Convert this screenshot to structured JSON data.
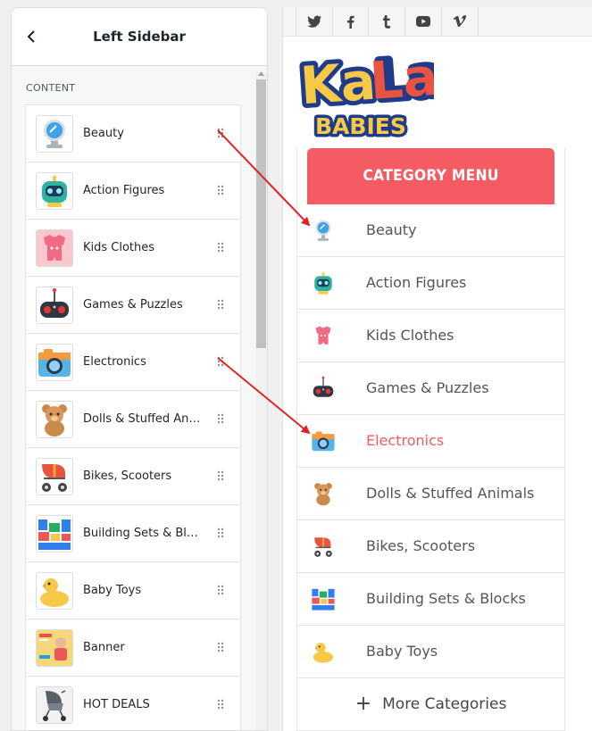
{
  "sidebar": {
    "title": "Left Sidebar",
    "section_label": "CONTENT",
    "items": [
      {
        "label": "Beauty",
        "icon": "mirror-icon"
      },
      {
        "label": "Action Figures",
        "icon": "robot-icon"
      },
      {
        "label": "Kids Clothes",
        "icon": "onesie-icon"
      },
      {
        "label": "Games & Puzzles",
        "icon": "gamepad-icon"
      },
      {
        "label": "Electronics",
        "icon": "camera-icon"
      },
      {
        "label": "Dolls & Stuffed Ani...",
        "icon": "teddy-bear-icon"
      },
      {
        "label": "Bikes, Scooters",
        "icon": "stroller-icon"
      },
      {
        "label": "Building Sets & Blocks",
        "icon": "blocks-icon"
      },
      {
        "label": "Baby Toys",
        "icon": "duck-icon"
      },
      {
        "label": "Banner",
        "icon": "banner-image-icon"
      },
      {
        "label": "HOT DEALS",
        "icon": "stroller-photo-icon"
      }
    ]
  },
  "preview": {
    "social": [
      "twitter-icon",
      "facebook-icon",
      "tumblr-icon",
      "youtube-icon",
      "vimeo-icon"
    ],
    "logo": {
      "line1": "KaLa",
      "line2": "BABIES"
    },
    "category_menu": {
      "header": "CATEGORY MENU",
      "items": [
        {
          "label": "Beauty",
          "icon": "mirror-icon"
        },
        {
          "label": "Action Figures",
          "icon": "robot-icon"
        },
        {
          "label": "Kids Clothes",
          "icon": "onesie-icon"
        },
        {
          "label": "Games & Puzzles",
          "icon": "gamepad-icon"
        },
        {
          "label": "Electronics",
          "icon": "camera-icon",
          "active": true
        },
        {
          "label": "Dolls & Stuffed Animals",
          "icon": "teddy-bear-icon"
        },
        {
          "label": "Bikes, Scooters",
          "icon": "stroller-icon"
        },
        {
          "label": "Building Sets & Blocks",
          "icon": "blocks-icon"
        },
        {
          "label": "Baby Toys",
          "icon": "duck-icon"
        }
      ],
      "more_label": "More Categories",
      "more_icon": "plus-icon"
    }
  },
  "colors": {
    "accent": "#f45b63",
    "arrow": "#e02424",
    "text": "#555555"
  }
}
